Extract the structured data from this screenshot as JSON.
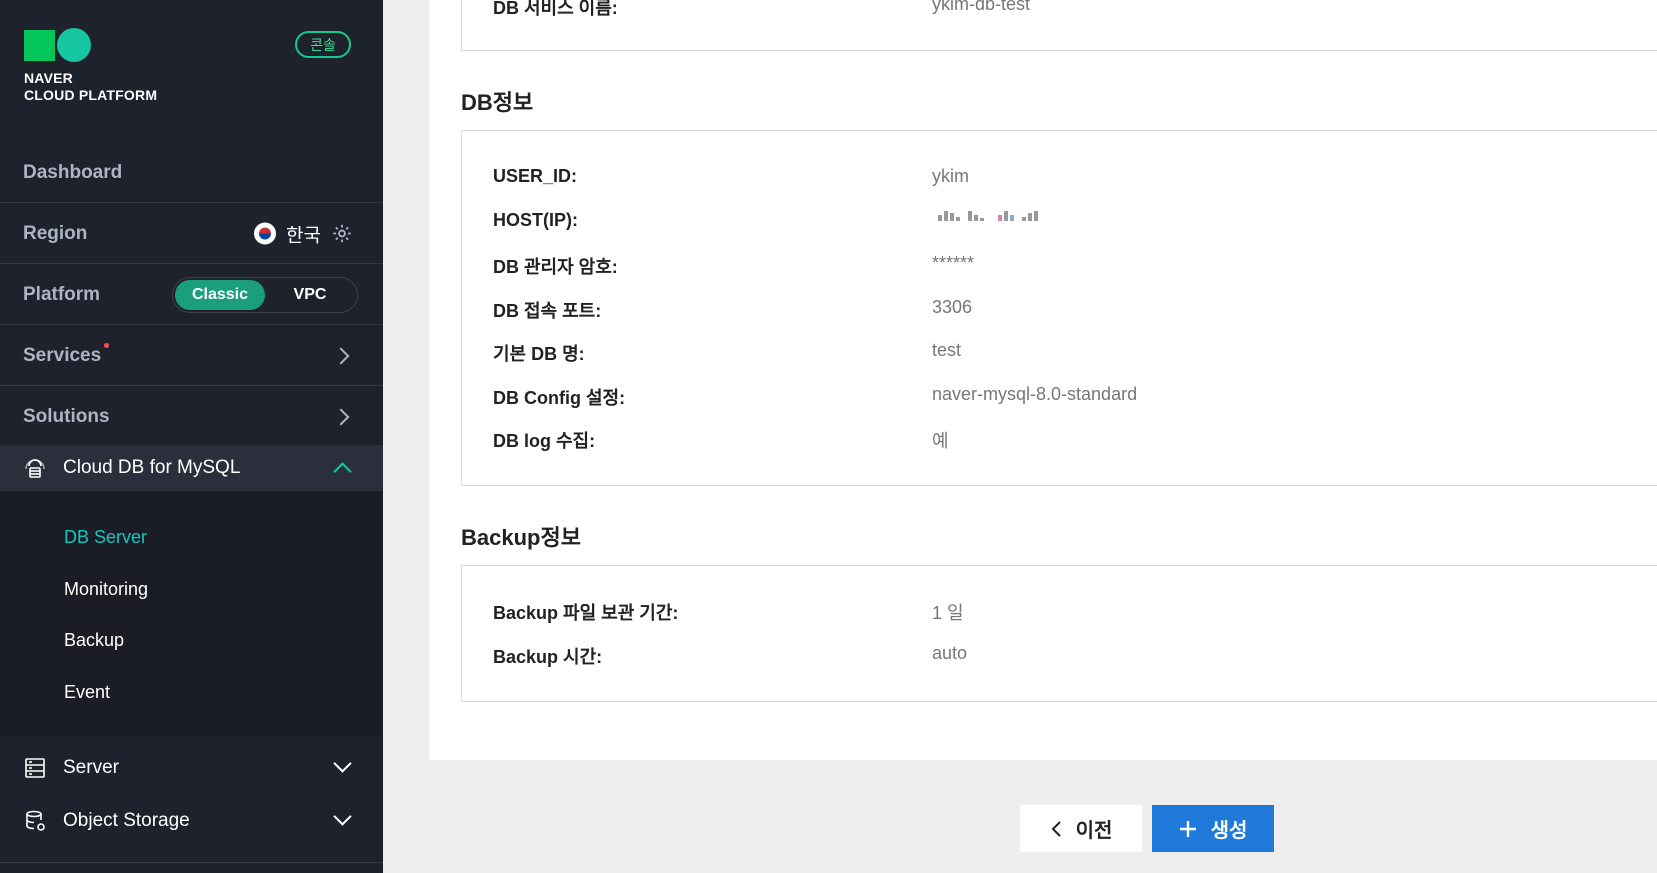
{
  "brand": {
    "line1": "NAVER",
    "line2": "CLOUD PLATFORM",
    "console_badge": "콘솔"
  },
  "sidebar": {
    "dashboard": "Dashboard",
    "region_label": "Region",
    "region_value": "한국",
    "platform_label": "Platform",
    "platform_options": [
      "Classic",
      "VPC"
    ],
    "platform_selected": "Classic",
    "services": "Services",
    "solutions": "Solutions",
    "active_section": "Cloud DB for MySQL",
    "submenu": [
      "DB Server",
      "Monitoring",
      "Backup",
      "Event"
    ],
    "submenu_active": "DB Server",
    "bottom_items": [
      "Server",
      "Object Storage"
    ]
  },
  "top_partial": {
    "label": "DB 서비스 이름:",
    "value": "ykim-db-test"
  },
  "db_info": {
    "title": "DB정보",
    "rows": [
      {
        "label": "USER_ID:",
        "value": "ykim"
      },
      {
        "label": "HOST(IP):",
        "value": ""
      },
      {
        "label": "DB 관리자 암호:",
        "value": "******"
      },
      {
        "label": "DB 접속 포트:",
        "value": "3306"
      },
      {
        "label": "기본 DB 명:",
        "value": "test"
      },
      {
        "label": "DB Config 설정:",
        "value": "naver-mysql-8.0-standard"
      },
      {
        "label": "DB log 수집:",
        "value": "예"
      }
    ]
  },
  "backup_info": {
    "title": "Backup정보",
    "rows": [
      {
        "label": "Backup 파일 보관 기간:",
        "value": "1 일"
      },
      {
        "label": "Backup 시간:",
        "value": "auto"
      }
    ]
  },
  "buttons": {
    "prev": "이전",
    "create": "생성"
  },
  "colors": {
    "sidebar_bg": "#1e222c",
    "accent": "#16c6a0",
    "primary_button": "#1f7ad9"
  }
}
